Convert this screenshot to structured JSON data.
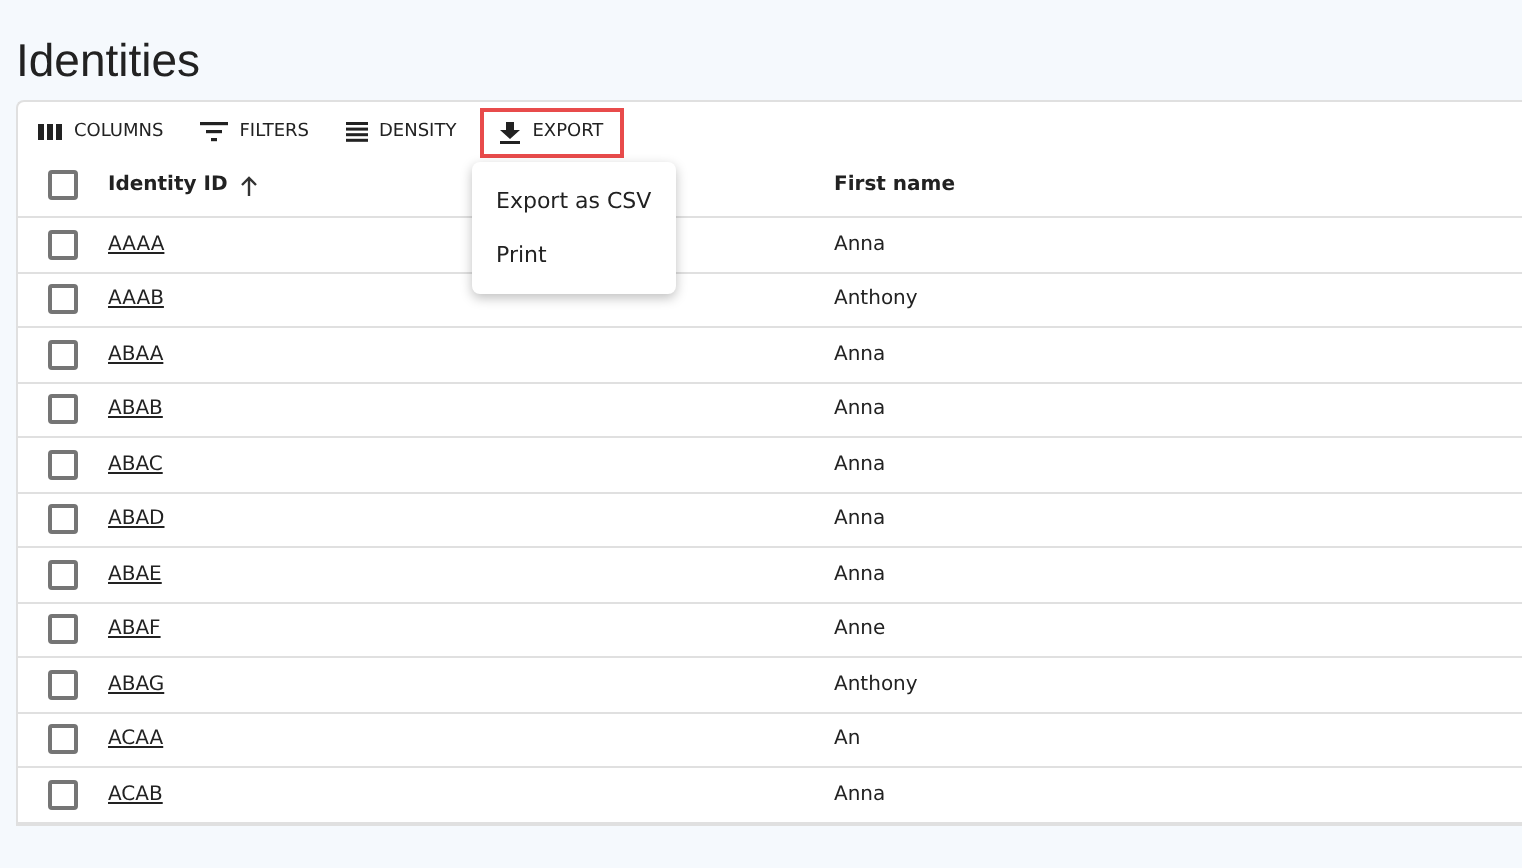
{
  "page": {
    "title": "Identities"
  },
  "toolbar": [
    {
      "kind": "columns",
      "label": "COLUMNS",
      "highlighted": false
    },
    {
      "kind": "filters",
      "label": "FILTERS",
      "highlighted": false
    },
    {
      "kind": "density",
      "label": "DENSITY",
      "highlighted": false
    },
    {
      "kind": "export",
      "label": "EXPORT",
      "highlighted": true
    }
  ],
  "export_menu": {
    "open": true,
    "items": [
      "Export as CSV",
      "Print"
    ]
  },
  "table": {
    "select_all_checked": false,
    "columns": [
      {
        "label": "Identity ID",
        "sorted": true
      },
      {
        "label": "First name",
        "sorted": false
      }
    ],
    "rows": [
      {
        "id": "AAAA",
        "first_name": "Anna",
        "checked": false
      },
      {
        "id": "AAAB",
        "first_name": "Anthony",
        "checked": false
      },
      {
        "id": "ABAA",
        "first_name": "Anna",
        "checked": false
      },
      {
        "id": "ABAB",
        "first_name": "Anna",
        "checked": false
      },
      {
        "id": "ABAC",
        "first_name": "Anna",
        "checked": false
      },
      {
        "id": "ABAD",
        "first_name": "Anna",
        "checked": false
      },
      {
        "id": "ABAE",
        "first_name": "Anna",
        "checked": false
      },
      {
        "id": "ABAF",
        "first_name": "Anne",
        "checked": false
      },
      {
        "id": "ABAG",
        "first_name": "Anthony",
        "checked": false
      },
      {
        "id": "ACAA",
        "first_name": "An",
        "checked": false
      },
      {
        "id": "ACAB",
        "first_name": "Anna",
        "checked": false
      }
    ]
  }
}
